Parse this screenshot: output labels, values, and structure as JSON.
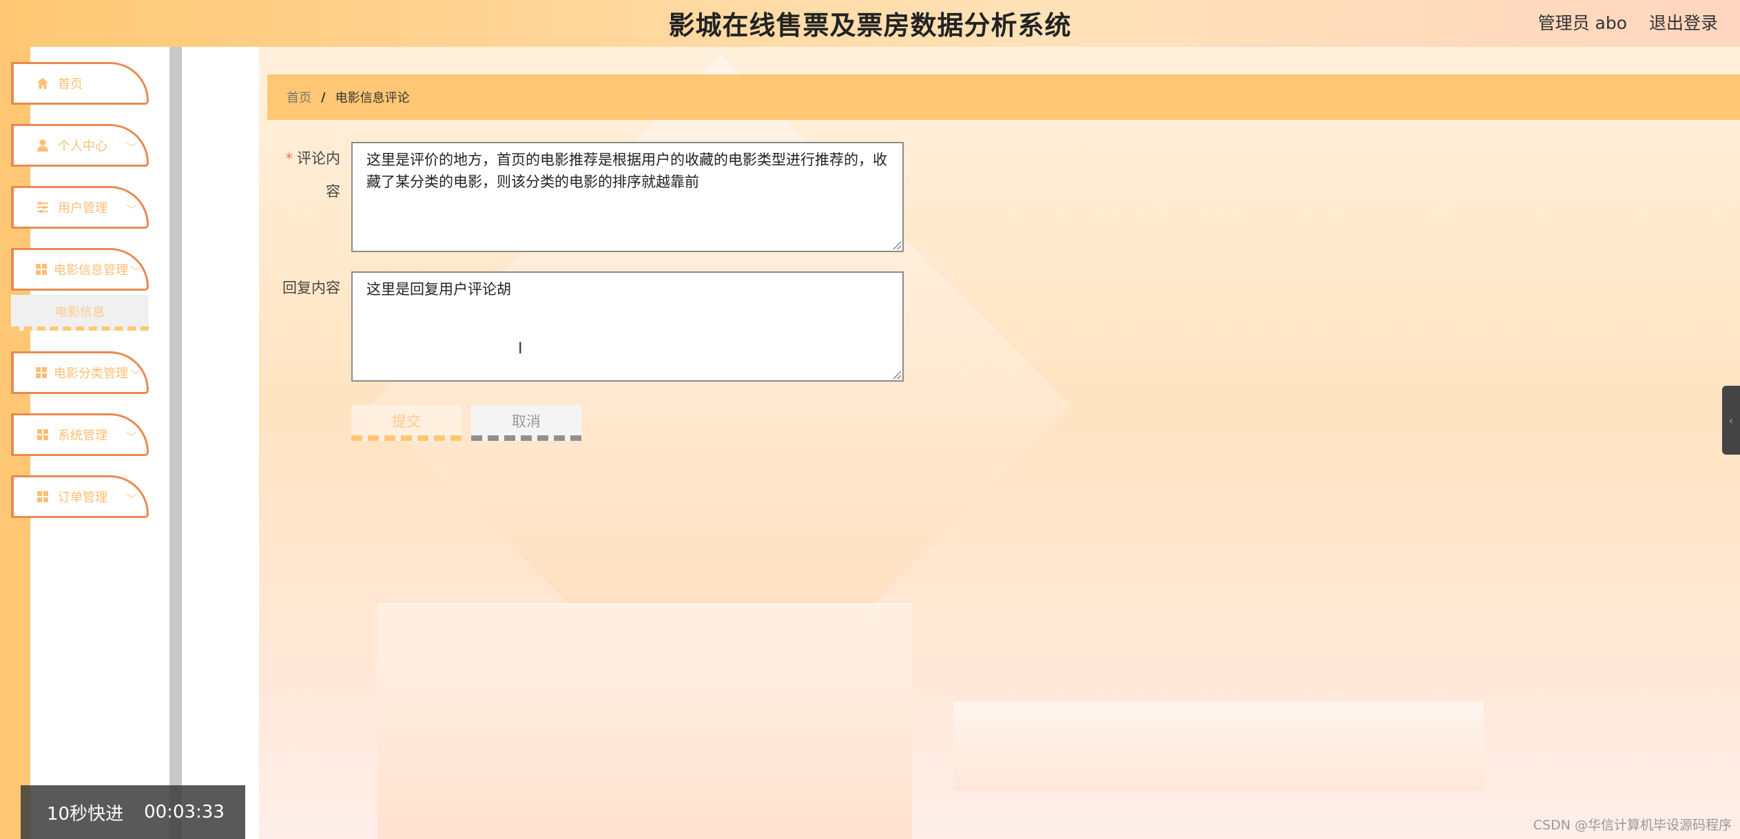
{
  "header": {
    "title": "影城在线售票及票房数据分析系统",
    "user": "管理员 abo",
    "logout": "退出登录"
  },
  "sidebar": {
    "items": [
      {
        "label": "首页",
        "icon": "home-icon"
      },
      {
        "label": "个人中心",
        "icon": "user-icon"
      },
      {
        "label": "用户管理",
        "icon": "sliders-icon"
      },
      {
        "label": "电影信息管理",
        "icon": "grid-icon"
      },
      {
        "label": "电影分类管理",
        "icon": "grid-icon"
      },
      {
        "label": "系统管理",
        "icon": "grid-icon"
      },
      {
        "label": "订单管理",
        "icon": "grid-icon"
      }
    ],
    "submenu": {
      "label": "电影信息"
    }
  },
  "breadcrumb": {
    "home": "首页",
    "separator": "/",
    "current": "电影信息评论"
  },
  "form": {
    "comment_label_line1": "评论内",
    "comment_label_line2": "容",
    "required_mark": "*",
    "comment_value": "这里是评价的地方，首页的电影推荐是根据用户的收藏的电影类型进行推荐的，收藏了某分类的电影，则该分类的电影的排序就越靠前",
    "reply_label": "回复内容",
    "reply_value": "这里是回复用户评论胡",
    "submit_label": "提交",
    "cancel_label": "取消"
  },
  "overlay": {
    "fast_forward": "10秒快进",
    "time": "00:03:33"
  },
  "watermark": "CSDN @华信计算机毕设源码程序",
  "colors": {
    "accent": "#ffc773",
    "menu_border": "#e98a50",
    "menu_text": "#ffbe73"
  }
}
